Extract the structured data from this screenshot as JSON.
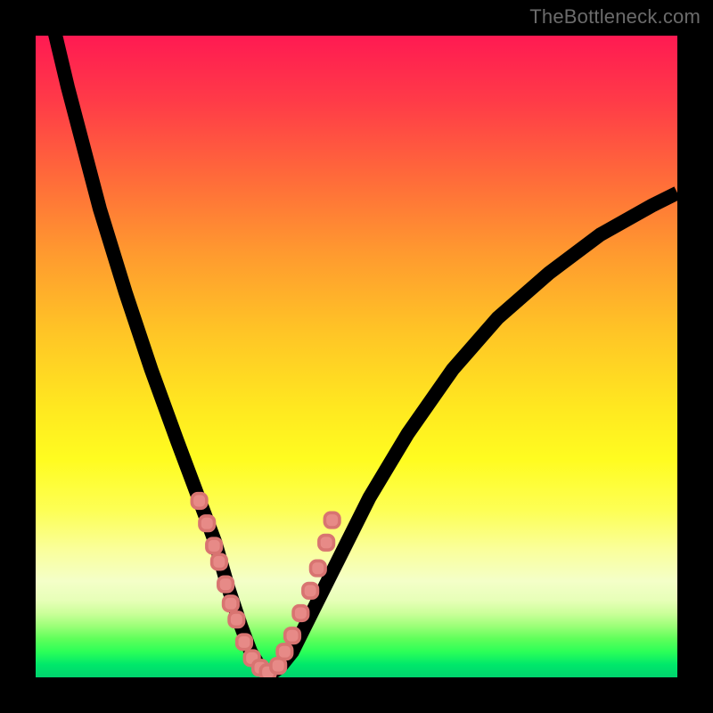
{
  "watermark": "TheBottleneck.com",
  "chart_data": {
    "type": "line",
    "title": "",
    "xlabel": "",
    "ylabel": "",
    "xlim": [
      0,
      100
    ],
    "ylim": [
      0,
      100
    ],
    "grid": false,
    "legend": false,
    "gradient_colors_top_to_bottom": [
      "#ff1a52",
      "#ff9a2f",
      "#fffc20",
      "#00d36e"
    ],
    "series": [
      {
        "name": "bottleneck-curve",
        "x": [
          0,
          5,
          10,
          14,
          18,
          22,
          25,
          28,
          30,
          32,
          33.5,
          35,
          36.5,
          38,
          40,
          43,
          47,
          52,
          58,
          65,
          72,
          80,
          88,
          96,
          100
        ],
        "y": [
          113,
          92,
          73,
          60,
          48,
          37,
          29,
          21,
          14,
          8,
          4,
          1.5,
          0.5,
          1.5,
          4,
          10,
          18,
          28,
          38,
          48,
          56,
          63,
          69,
          73.5,
          75.5
        ]
      }
    ],
    "markers": {
      "name": "highlight-points",
      "color": "#e78a87",
      "x": [
        25.5,
        26.7,
        27.8,
        28.6,
        29.6,
        30.4,
        31.3,
        32.5,
        33.7,
        35.0,
        36.2,
        37.8,
        38.8,
        40.0,
        41.3,
        42.8,
        44.0,
        45.3,
        46.2
      ],
      "y": [
        27.5,
        24.0,
        20.5,
        18.0,
        14.5,
        11.5,
        9.0,
        5.5,
        3.0,
        1.5,
        0.8,
        1.8,
        4.0,
        6.5,
        10.0,
        13.5,
        17.0,
        21.0,
        24.5
      ]
    }
  }
}
